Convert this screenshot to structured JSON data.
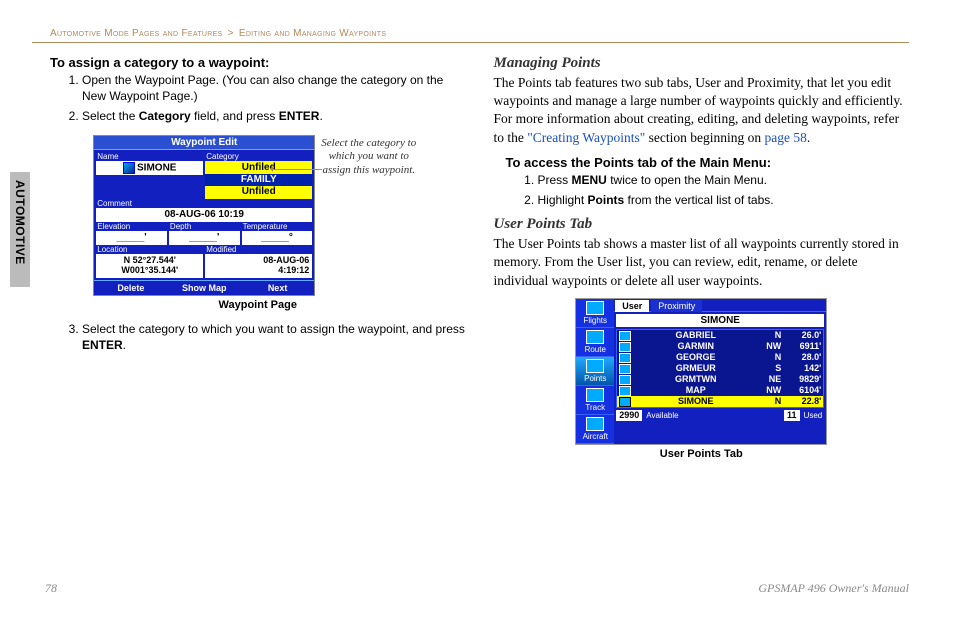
{
  "breadcrumb": {
    "section": "Automotive Mode Pages and Features",
    "sep": ">",
    "sub": "Editing and Managing Waypoints"
  },
  "sidetab": "AUTOMOTIVE",
  "left": {
    "h1": "To assign a category to a waypoint:",
    "steps": [
      "Open the Waypoint Page. (You can also change the category on the New Waypoint Page.)",
      {
        "pre": "Select the ",
        "b1": "Category",
        "mid": " field, and press ",
        "b2": "ENTER",
        "post": "."
      },
      {
        "pre": "Select the category to which you want to assign the waypoint, and press ",
        "b1": "ENTER",
        "post": "."
      }
    ],
    "note": "Select the category to which you want to assign this waypoint.",
    "fig_caption": "Waypoint Page",
    "device": {
      "title": "Waypoint Edit",
      "labels": {
        "name": "Name",
        "category": "Category",
        "comment": "Comment",
        "elevation": "Elevation",
        "depth": "Depth",
        "temperature": "Temperature",
        "location": "Location",
        "modified": "Modified"
      },
      "name": "SIMONE",
      "category": "Unfiled",
      "options": [
        "Unfiled",
        "FAMILY",
        "Unfiled"
      ],
      "comment": "08-AUG-06 10:19",
      "elevation": "_____'",
      "depth": "_____'",
      "temperature": "_____°",
      "location": "N 52°27.544'\\nW001°35.144'",
      "modified": "08-AUG-06\\n4:19:12",
      "softkeys": [
        "Delete",
        "Show Map",
        "Next"
      ]
    }
  },
  "right": {
    "h1": "Managing Points",
    "p1a": "The Points tab features two sub tabs, User and Proximity, that let you edit waypoints and manage a large number of waypoints quickly and efficiently. For more information about creating, editing, and deleting waypoints, refer to the ",
    "p1link1": "\"Creating Waypoints\"",
    "p1b": " section beginning on ",
    "p1link2": "page 58",
    "p1c": ".",
    "h2": "To access the Points tab of the Main Menu:",
    "steps2": [
      {
        "pre": "Press ",
        "b1": "MENU",
        "post": " twice to open the Main Menu."
      },
      {
        "pre": "Highlight ",
        "b1": "Points",
        "post": " from the vertical list of tabs."
      }
    ],
    "h3": "User Points Tab",
    "p2": "The User Points tab shows a master list of all waypoints currently stored in memory. From the User list, you can review, edit, rename, or delete individual waypoints or delete all user waypoints.",
    "fig_caption": "User Points Tab",
    "device": {
      "sidebar": [
        {
          "icon": "flights-icon",
          "label": "Flights"
        },
        {
          "icon": "route-icon",
          "label": "Route"
        },
        {
          "icon": "points-icon",
          "label": "Points",
          "selected": true
        },
        {
          "icon": "track-icon",
          "label": "Track"
        },
        {
          "icon": "aircraft-icon",
          "label": "Aircraft"
        }
      ],
      "tabs": [
        "User",
        "Proximity"
      ],
      "search": "SIMONE",
      "rows": [
        {
          "name": "GABRIEL",
          "dir": "N",
          "dist": "26.0'"
        },
        {
          "name": "GARMIN",
          "dir": "NW",
          "dist": "6911'"
        },
        {
          "name": "GEORGE",
          "dir": "N",
          "dist": "28.0'"
        },
        {
          "name": "GRMEUR",
          "dir": "S",
          "dist": "142'"
        },
        {
          "name": "GRMTWN",
          "dir": "NE",
          "dist": "9829'"
        },
        {
          "name": "MAP",
          "dir": "NW",
          "dist": "6104'"
        },
        {
          "name": "SIMONE",
          "dir": "N",
          "dist": "22.8'",
          "hl": true
        }
      ],
      "footer": {
        "available_n": "2990",
        "available_l": "Available",
        "used_n": "11",
        "used_l": "Used"
      }
    }
  },
  "footer": {
    "page": "78",
    "title": "GPSMAP 496 Owner's Manual"
  }
}
